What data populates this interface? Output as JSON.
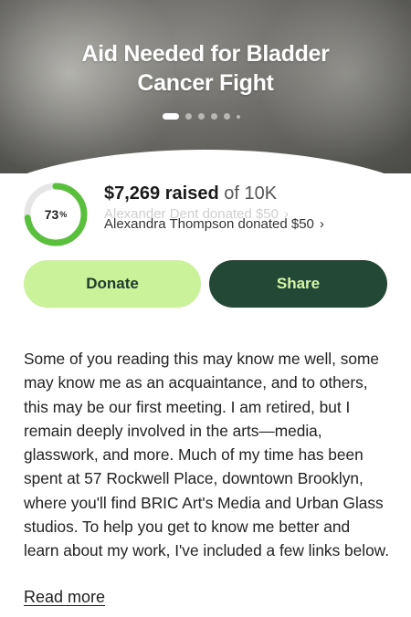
{
  "hero": {
    "title_line1": "Aid Needed for Bladder",
    "title_line2": "Cancer Fight",
    "carousel": {
      "count": 6,
      "active_index": 0
    }
  },
  "progress": {
    "percent": 73,
    "percent_value": "73",
    "percent_sign": "%",
    "ring_color": "#5bbf3e",
    "track_color": "#e6e6e6"
  },
  "raised": {
    "amount": "$7,269 raised",
    "of_goal": "of 10K"
  },
  "donors": {
    "faded": "Alexander Dent donated $50",
    "current": "Alexandra Thompson donated $50",
    "chevron": "›"
  },
  "actions": {
    "donate_label": "Donate",
    "share_label": "Share"
  },
  "story": {
    "text": "Some of you reading this may know me well, some may know me as an acquaintance, and to others, this may be our first meeting. I am retired, but I remain deeply involved in the arts—media, glasswork, and more. Much of my time has been spent at 57 Rockwell Place, downtown Brooklyn, where you'll find BRIC Art's Media and Urban Glass studios. To help you get to know me better and learn about my work, I've included a few links below.",
    "read_more": "Read more"
  }
}
